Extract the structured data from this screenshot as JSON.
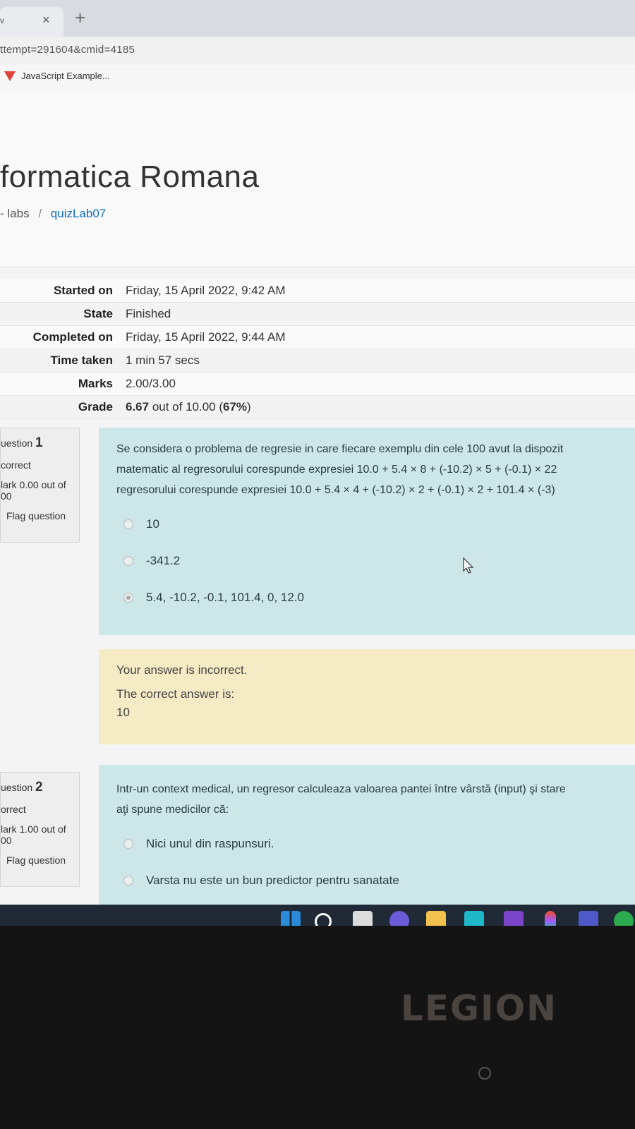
{
  "browser": {
    "tab_label": "v",
    "tab_close": "×",
    "new_tab": "+",
    "url": "ttempt=291604&cmid=4185",
    "bookmark_label": "JavaScript Example..."
  },
  "page": {
    "title": "formatica Romana",
    "breadcrumb_prefix": "- labs",
    "breadcrumb_separator": "/",
    "breadcrumb_link": "quizLab07"
  },
  "summary": [
    {
      "label": "Started on",
      "value": "Friday, 15 April 2022, 9:42 AM"
    },
    {
      "label": "State",
      "value": "Finished"
    },
    {
      "label": "Completed on",
      "value": "Friday, 15 April 2022, 9:44 AM"
    },
    {
      "label": "Time taken",
      "value": "1 min 57 secs"
    },
    {
      "label": "Marks",
      "value": "2.00/3.00"
    },
    {
      "label": "Grade",
      "value_bold": "6.67",
      "value_mid": " out of 10.00 (",
      "value_pct": "67%",
      "value_end": ")"
    }
  ],
  "questions": [
    {
      "number_prefix": "uestion",
      "number": "1",
      "status": "correct",
      "mark_line1": "lark 0.00 out of",
      "mark_line2": "00",
      "flag": "Flag question",
      "text_lines": [
        "Se considera o problema de regresie in care fiecare exemplu din cele 100 avut la dispozit",
        "matematic al regresorului corespunde expresiei 10.0 + 5.4 × 8 + (-10.2) × 5 + (-0.1) × 22",
        "regresorului corespunde expresiei 10.0 + 5.4 × 4 + (-10.2) × 2 + (-0.1) × 2 + 101.4 × (-3)"
      ],
      "answers": [
        "10",
        "-341.2",
        "5.4, -10.2, -0.1, 101.4, 0, 12.0"
      ],
      "selected_index": 2,
      "feedback": {
        "incorrect": "Your answer is incorrect.",
        "correct_label": "The correct answer is:",
        "correct_value": "10"
      }
    },
    {
      "number_prefix": "uestion",
      "number": "2",
      "status": "orrect",
      "mark_line1": "lark 1.00 out of",
      "mark_line2": "00",
      "flag": "Flag question",
      "text_lines": [
        "Intr-un context medical, un regresor calculeaza valoarea pantei între vârstă (input) şi stare",
        "aţi spune medicilor că:"
      ],
      "answers": [
        "Nici unul din raspunsuri.",
        "Varsta nu este un bun predictor pentru sanatate"
      ]
    }
  ],
  "laptop": {
    "brand": "LEGION"
  },
  "colors": {
    "link": "#0f6cbf",
    "question_bg": "#cde6e7",
    "feedback_bg": "#f5ebc4",
    "taskbar_bg": "#1f2a36"
  }
}
